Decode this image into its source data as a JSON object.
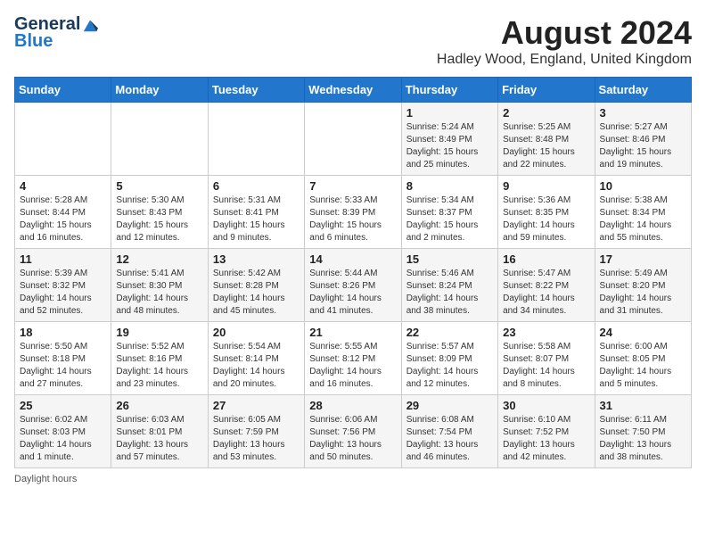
{
  "header": {
    "logo_general": "General",
    "logo_blue": "Blue",
    "month_title": "August 2024",
    "location": "Hadley Wood, England, United Kingdom"
  },
  "days_of_week": [
    "Sunday",
    "Monday",
    "Tuesday",
    "Wednesday",
    "Thursday",
    "Friday",
    "Saturday"
  ],
  "weeks": [
    [
      {
        "day": "",
        "info": ""
      },
      {
        "day": "",
        "info": ""
      },
      {
        "day": "",
        "info": ""
      },
      {
        "day": "",
        "info": ""
      },
      {
        "day": "1",
        "info": "Sunrise: 5:24 AM\nSunset: 8:49 PM\nDaylight: 15 hours\nand 25 minutes."
      },
      {
        "day": "2",
        "info": "Sunrise: 5:25 AM\nSunset: 8:48 PM\nDaylight: 15 hours\nand 22 minutes."
      },
      {
        "day": "3",
        "info": "Sunrise: 5:27 AM\nSunset: 8:46 PM\nDaylight: 15 hours\nand 19 minutes."
      }
    ],
    [
      {
        "day": "4",
        "info": "Sunrise: 5:28 AM\nSunset: 8:44 PM\nDaylight: 15 hours\nand 16 minutes."
      },
      {
        "day": "5",
        "info": "Sunrise: 5:30 AM\nSunset: 8:43 PM\nDaylight: 15 hours\nand 12 minutes."
      },
      {
        "day": "6",
        "info": "Sunrise: 5:31 AM\nSunset: 8:41 PM\nDaylight: 15 hours\nand 9 minutes."
      },
      {
        "day": "7",
        "info": "Sunrise: 5:33 AM\nSunset: 8:39 PM\nDaylight: 15 hours\nand 6 minutes."
      },
      {
        "day": "8",
        "info": "Sunrise: 5:34 AM\nSunset: 8:37 PM\nDaylight: 15 hours\nand 2 minutes."
      },
      {
        "day": "9",
        "info": "Sunrise: 5:36 AM\nSunset: 8:35 PM\nDaylight: 14 hours\nand 59 minutes."
      },
      {
        "day": "10",
        "info": "Sunrise: 5:38 AM\nSunset: 8:34 PM\nDaylight: 14 hours\nand 55 minutes."
      }
    ],
    [
      {
        "day": "11",
        "info": "Sunrise: 5:39 AM\nSunset: 8:32 PM\nDaylight: 14 hours\nand 52 minutes."
      },
      {
        "day": "12",
        "info": "Sunrise: 5:41 AM\nSunset: 8:30 PM\nDaylight: 14 hours\nand 48 minutes."
      },
      {
        "day": "13",
        "info": "Sunrise: 5:42 AM\nSunset: 8:28 PM\nDaylight: 14 hours\nand 45 minutes."
      },
      {
        "day": "14",
        "info": "Sunrise: 5:44 AM\nSunset: 8:26 PM\nDaylight: 14 hours\nand 41 minutes."
      },
      {
        "day": "15",
        "info": "Sunrise: 5:46 AM\nSunset: 8:24 PM\nDaylight: 14 hours\nand 38 minutes."
      },
      {
        "day": "16",
        "info": "Sunrise: 5:47 AM\nSunset: 8:22 PM\nDaylight: 14 hours\nand 34 minutes."
      },
      {
        "day": "17",
        "info": "Sunrise: 5:49 AM\nSunset: 8:20 PM\nDaylight: 14 hours\nand 31 minutes."
      }
    ],
    [
      {
        "day": "18",
        "info": "Sunrise: 5:50 AM\nSunset: 8:18 PM\nDaylight: 14 hours\nand 27 minutes."
      },
      {
        "day": "19",
        "info": "Sunrise: 5:52 AM\nSunset: 8:16 PM\nDaylight: 14 hours\nand 23 minutes."
      },
      {
        "day": "20",
        "info": "Sunrise: 5:54 AM\nSunset: 8:14 PM\nDaylight: 14 hours\nand 20 minutes."
      },
      {
        "day": "21",
        "info": "Sunrise: 5:55 AM\nSunset: 8:12 PM\nDaylight: 14 hours\nand 16 minutes."
      },
      {
        "day": "22",
        "info": "Sunrise: 5:57 AM\nSunset: 8:09 PM\nDaylight: 14 hours\nand 12 minutes."
      },
      {
        "day": "23",
        "info": "Sunrise: 5:58 AM\nSunset: 8:07 PM\nDaylight: 14 hours\nand 8 minutes."
      },
      {
        "day": "24",
        "info": "Sunrise: 6:00 AM\nSunset: 8:05 PM\nDaylight: 14 hours\nand 5 minutes."
      }
    ],
    [
      {
        "day": "25",
        "info": "Sunrise: 6:02 AM\nSunset: 8:03 PM\nDaylight: 14 hours\nand 1 minute."
      },
      {
        "day": "26",
        "info": "Sunrise: 6:03 AM\nSunset: 8:01 PM\nDaylight: 13 hours\nand 57 minutes."
      },
      {
        "day": "27",
        "info": "Sunrise: 6:05 AM\nSunset: 7:59 PM\nDaylight: 13 hours\nand 53 minutes."
      },
      {
        "day": "28",
        "info": "Sunrise: 6:06 AM\nSunset: 7:56 PM\nDaylight: 13 hours\nand 50 minutes."
      },
      {
        "day": "29",
        "info": "Sunrise: 6:08 AM\nSunset: 7:54 PM\nDaylight: 13 hours\nand 46 minutes."
      },
      {
        "day": "30",
        "info": "Sunrise: 6:10 AM\nSunset: 7:52 PM\nDaylight: 13 hours\nand 42 minutes."
      },
      {
        "day": "31",
        "info": "Sunrise: 6:11 AM\nSunset: 7:50 PM\nDaylight: 13 hours\nand 38 minutes."
      }
    ]
  ],
  "footer": {
    "note": "Daylight hours"
  }
}
